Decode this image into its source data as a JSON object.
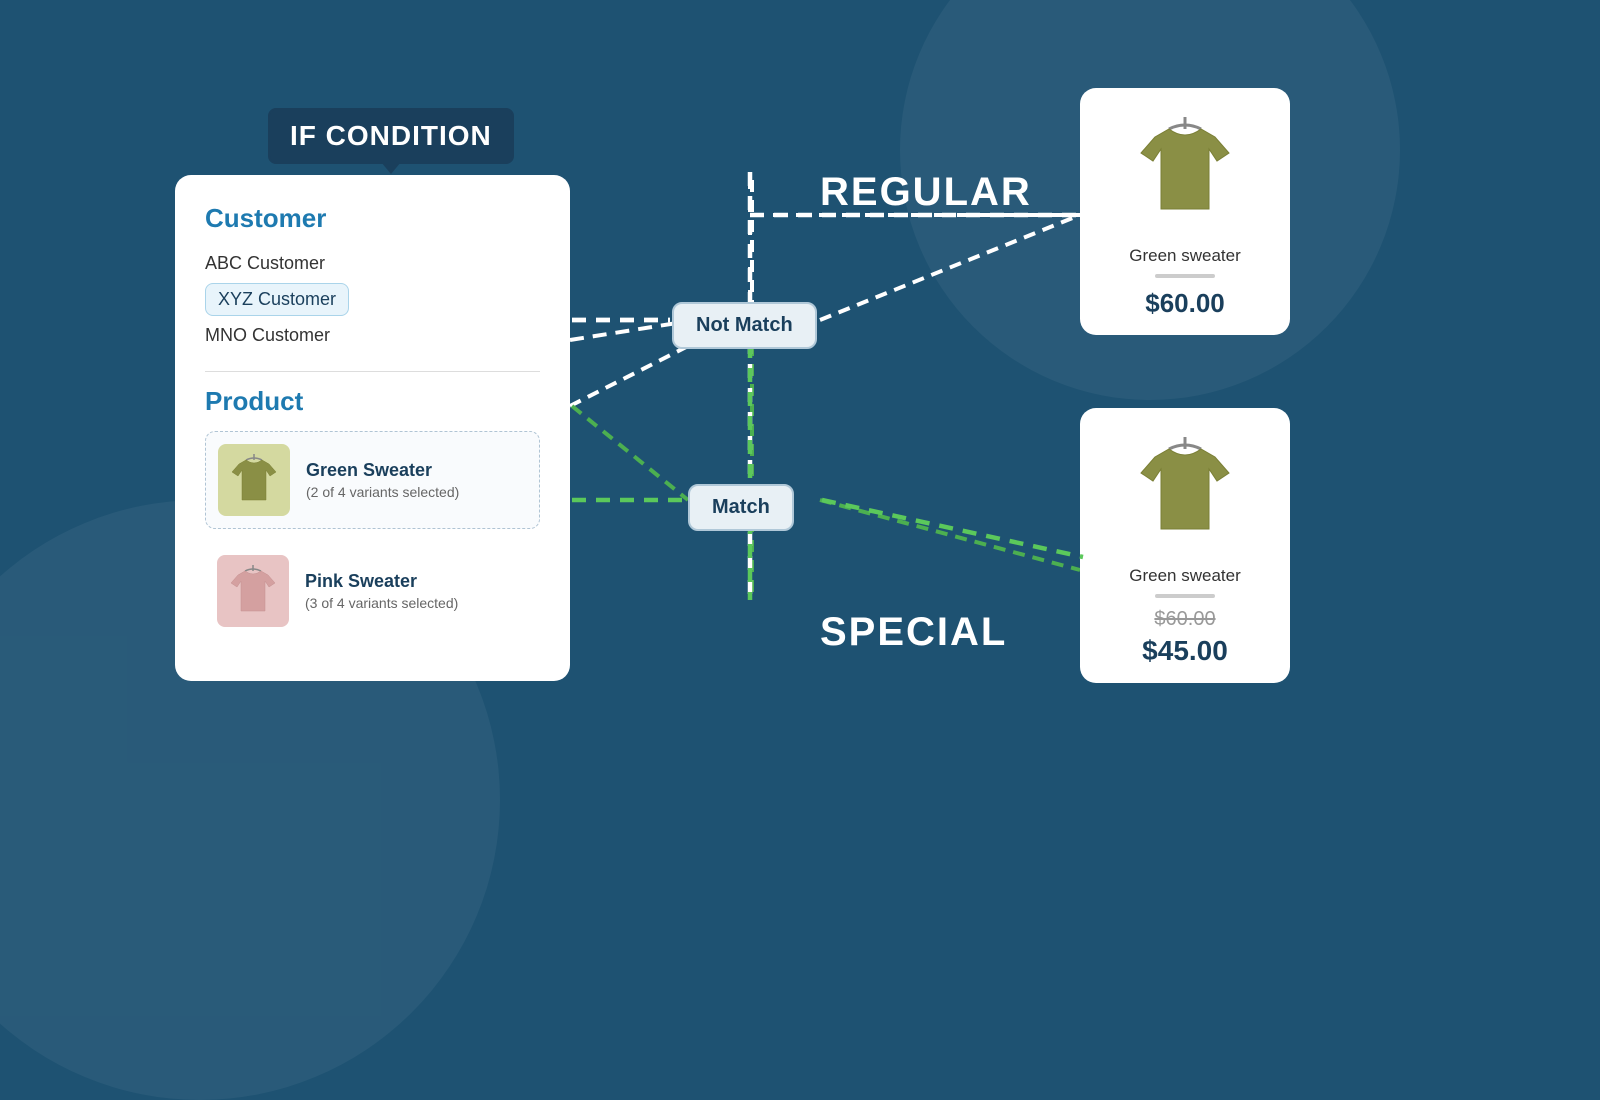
{
  "badge": {
    "label": "IF CONDITION"
  },
  "panel": {
    "customer_section": {
      "title": "Customer",
      "items": [
        {
          "name": "ABC Customer",
          "selected": false
        },
        {
          "name": "XYZ Customer",
          "selected": true
        },
        {
          "name": "MNO Customer",
          "selected": false
        }
      ]
    },
    "product_section": {
      "title": "Product",
      "items": [
        {
          "name": "Green Sweater",
          "variants": "(2 of 4 variants selected)",
          "type": "green"
        },
        {
          "name": "Pink Sweater",
          "variants": "(3 of 4 variants selected)",
          "type": "pink"
        }
      ]
    }
  },
  "nodes": {
    "not_match": "Not Match",
    "match": "Match"
  },
  "labels": {
    "regular": "REGULAR",
    "special": "SPECIAL"
  },
  "cards": {
    "regular": {
      "name": "Green sweater",
      "price": "$60.00"
    },
    "special": {
      "name": "Green sweater",
      "original_price": "$60.00",
      "special_price": "$45.00"
    }
  }
}
